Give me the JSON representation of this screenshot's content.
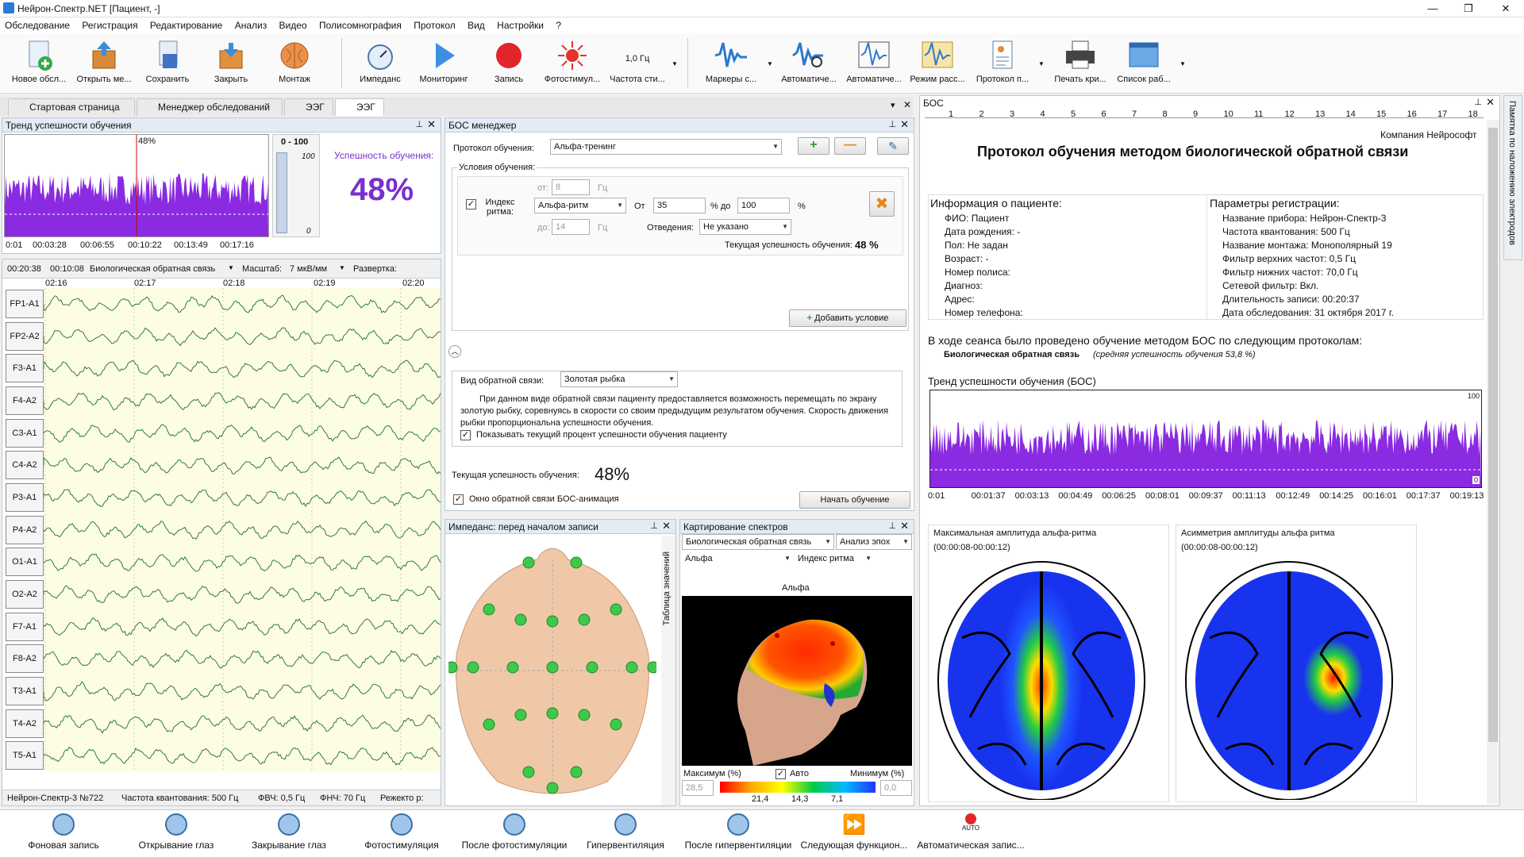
{
  "app": {
    "title": "Нейрон-Спектр.NET [Пациент, -]"
  },
  "menu": [
    "Обследование",
    "Регистрация",
    "Редактирование",
    "Анализ",
    "Видео",
    "Полисомнография",
    "Протокол",
    "Вид",
    "Настройки",
    "?"
  ],
  "toolbar": {
    "new": "Новое обсл...",
    "open": "Открыть ме...",
    "save": "Сохранить",
    "close": "Закрыть",
    "montage": "Монтаж",
    "impedance": "Импеданс",
    "monitoring": "Мониторинг",
    "record": "Запись",
    "photostim": "Фотостимул...",
    "freq_value": "1,0 Гц",
    "freq": "Частота сти...",
    "markers": "Маркеры с...",
    "auto1": "Автоматиче...",
    "auto2": "Автоматиче...",
    "viewmode": "Режим расс...",
    "protocol": "Протокол п...",
    "print": "Печать кри...",
    "worklist": "Список раб..."
  },
  "tabs": [
    "Стартовая страница",
    "Менеджер обследований",
    "ЭЭГ",
    "ЭЭГ"
  ],
  "trend": {
    "title": "Тренд успешности обучения",
    "pct_small": "48%",
    "range": "0 - 100",
    "scale_top": "100",
    "scale_bottom": "0",
    "success_label": "Успешность обучения:",
    "success_value": "48%",
    "times": [
      "0:01",
      "00:03:28",
      "00:06:55",
      "00:10:22",
      "00:13:49",
      "00:17:16"
    ]
  },
  "eeg": {
    "time_start": "00:20:38",
    "time_pos": "00:10:08",
    "mode": "Биологическая обратная связь",
    "scale_label": "Масштаб:",
    "scale": "7 мкВ/мм",
    "sweep": "Развертка:",
    "ticks": [
      "02:16",
      "02:17",
      "02:18",
      "02:19",
      "02:20"
    ],
    "channels": [
      "FP1-A1",
      "FP2-A2",
      "F3-A1",
      "F4-A2",
      "C3-A1",
      "C4-A2",
      "P3-A1",
      "P4-A2",
      "O1-A1",
      "O2-A2",
      "F7-A1",
      "F8-A2",
      "T3-A1",
      "T4-A2",
      "T5-A1"
    ],
    "status": {
      "device": "Нейрон-Спектр-3 №722",
      "sampling": "Частота квантования:  500 Гц",
      "hpf": "ФВЧ:  0,5 Гц",
      "lpf": "ФНЧ:  70 Гц",
      "mode": "Режекто р:"
    }
  },
  "bos": {
    "title": "БОС менеджер",
    "protocol_label": "Протокол обучения:",
    "protocol": "Альфа-тренинг",
    "conditions": "Условия обучения:",
    "from_label": "от:",
    "from_val": "8",
    "hz": "Гц",
    "index_label": "Индекс ритма:",
    "rhythm": "Альфа-ритм",
    "ot": "От",
    "ot_val": "35",
    "pct_do": "% до",
    "do_val": "100",
    "pct": "%",
    "to_label": "до:",
    "to_val": "14",
    "leads_label": "Отведения:",
    "leads": "Не указано",
    "cur_success_label": "Текущая успешность обучения:",
    "cur_success_val": "48 %",
    "add_condition": "Добавить условие",
    "fb_label": "Вид обратной связи:",
    "fb": "Золотая рыбка",
    "fb_desc": "При данном виде обратной связи пациенту предоставляется возможность перемещать по экрану золотую рыбку, соревнуясь в скорости со своим предыдущим результатом обучения. Скорость движения рыбки пропорциональна успешности обучения.",
    "show_pct": "Показывать текущий процент успешности обучения пациенту",
    "cur_label2": "Текущая успешность обучения:",
    "cur_val2": "48%",
    "anim_window": "Окно обратной связи БОС-анимация",
    "start": "Начать обучение"
  },
  "impedance": {
    "title": "Импеданс: перед началом записи",
    "side": "Таблица значений"
  },
  "spectra": {
    "title": "Картирование спектров",
    "mode": "Биологическая обратная связь",
    "epoch": "Анализ эпох",
    "band": "Альфа",
    "index": "Индекс ритма",
    "map_title": "Альфа",
    "max_label": "Максимум (%)",
    "auto": "Авто",
    "min_label": "Минимум (%)",
    "max_val": "28,5",
    "min_val": "0,0",
    "ticks": [
      "21,4",
      "14,3",
      "7,1"
    ]
  },
  "report": {
    "title": "БОС",
    "company": "Компания Нейрософт",
    "heading": "Протокол обучения методом биологической обратной связи",
    "patient_head": "Информация о пациенте:",
    "patient": [
      "ФИО: Пациент",
      "Дата рождения:  -",
      "Пол: Не задан",
      "Возраст: -",
      "Номер полиса:",
      "Диагноз:",
      "Адрес:",
      "Номер телефона:"
    ],
    "reg_head": "Параметры регистрации:",
    "reg": [
      "Название прибора: Нейрон-Спектр-3",
      "Частота квантования: 500 Гц",
      "Название монтажа: Монополярный 19",
      "Фильтр верхних частот: 0,5 Гц",
      "Фильтр нижних частот: 70,0 Гц",
      "Сетевой фильтр: Вкл.",
      "Длительность записи: 00:20:37",
      "Дата обследования: 31 октября 2017 г."
    ],
    "session": "В ходе сеанса было проведено обучение методом БОС по следующим протоколам:",
    "bold": "Биологическая обратная связь",
    "italic": "(средняя успешность обучения 53,8 %)",
    "trend_title": "Тренд успешности обучения (БОС)",
    "trend_top": "100",
    "trend_bottom": "0",
    "times": [
      "0:01",
      "00:01:37",
      "00:03:13",
      "00:04:49",
      "00:06:25",
      "00:08:01",
      "00:09:37",
      "00:11:13",
      "00:12:49",
      "00:14:25",
      "00:16:01",
      "00:17:37",
      "00:19:13"
    ],
    "map1_title": "Максимальная амплитуда альфа-ритма",
    "map1_time": "(00:00:08-00:00:12)",
    "map2_title": "Асимметрия амплитуды альфа ритма",
    "map2_time": "(00:00:08-00:00:12)",
    "side_tab": "Памятка по наложению электродов",
    "ruler": [
      "1",
      "2",
      "3",
      "4",
      "5",
      "6",
      "7",
      "8",
      "9",
      "10",
      "11",
      "12",
      "13",
      "14",
      "15",
      "16",
      "17",
      "18"
    ]
  },
  "bottom": [
    "Фоновая запись",
    "Открывание глаз",
    "Закрывание глаз",
    "Фотостимуляция",
    "После фотостимуляции",
    "Гипервентиляция",
    "После гипервентиляции",
    "Следующая функцион...",
    "Автоматическая запис..."
  ],
  "bottom_auto": "AUTO"
}
